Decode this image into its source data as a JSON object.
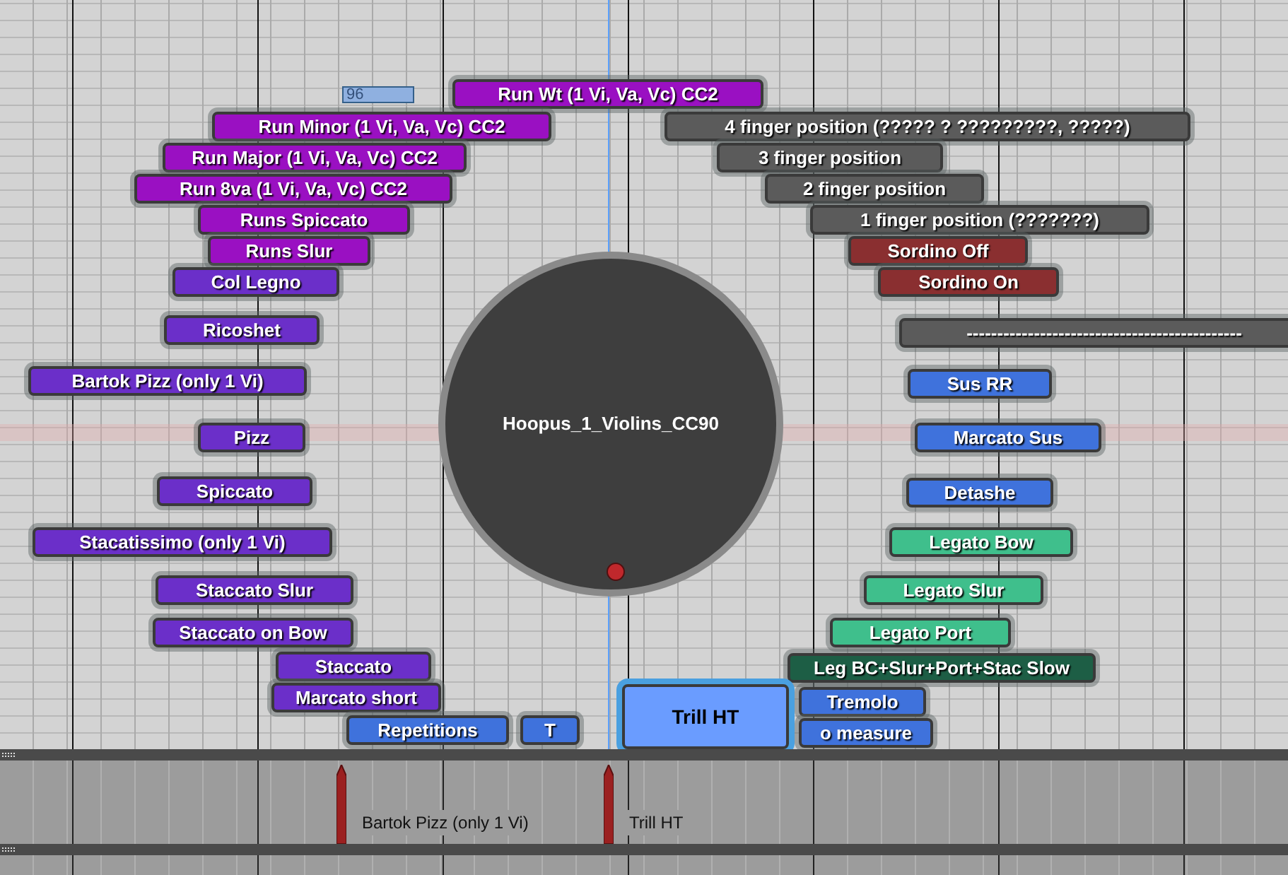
{
  "value_field": "96",
  "center": {
    "title": "Hoopus_1_Violins_CC90"
  },
  "buttons": [
    {
      "label": "Run Wt (1 Vi, Va, Vc) CC2",
      "color": "#9a10c2",
      "selected": false
    },
    {
      "label": "Run Minor (1 Vi, Va, Vc) CC2",
      "color": "#9a10c2",
      "selected": false
    },
    {
      "label": "Run Major (1 Vi, Va, Vc) CC2",
      "color": "#9a10c2",
      "selected": false
    },
    {
      "label": "Run 8va (1 Vi, Va, Vc) CC2",
      "color": "#9a10c2",
      "selected": false
    },
    {
      "label": "Runs Spiccato",
      "color": "#9a10c2",
      "selected": false
    },
    {
      "label": "Runs Slur",
      "color": "#9a10c2",
      "selected": false
    },
    {
      "label": "4 finger position (????? ? ?????????, ?????)",
      "color": "#5b5b5b",
      "selected": false
    },
    {
      "label": "3 finger position",
      "color": "#5b5b5b",
      "selected": false
    },
    {
      "label": "2 finger position",
      "color": "#5b5b5b",
      "selected": false
    },
    {
      "label": "1 finger position (???????)",
      "color": "#5b5b5b",
      "selected": false
    },
    {
      "label": "Sordino Off",
      "color": "#8a2f30",
      "selected": false
    },
    {
      "label": "Col Legno",
      "color": "#6b2fc9",
      "selected": false
    },
    {
      "label": "Sordino On",
      "color": "#8a2f30",
      "selected": false
    },
    {
      "label": "Ricoshet",
      "color": "#6b2fc9",
      "selected": false
    },
    {
      "label": "---------------------------------------------",
      "color": "#5b5b5b",
      "selected": false
    },
    {
      "label": "Sus RR",
      "color": "#3f72dc",
      "selected": false
    },
    {
      "label": "Bartok Pizz (only 1 Vi)",
      "color": "#6b2fc9",
      "selected": false
    },
    {
      "label": "Pizz",
      "color": "#6b2fc9",
      "selected": false
    },
    {
      "label": "Marcato Sus",
      "color": "#3f72dc",
      "selected": false
    },
    {
      "label": "Spiccato",
      "color": "#6b2fc9",
      "selected": false
    },
    {
      "label": "Detashe",
      "color": "#3f72dc",
      "selected": false
    },
    {
      "label": "Stacatissimo (only 1 Vi)",
      "color": "#6b2fc9",
      "selected": false
    },
    {
      "label": "Legato Bow",
      "color": "#3fbf8c",
      "selected": false
    },
    {
      "label": "Staccato Slur",
      "color": "#6b2fc9",
      "selected": false
    },
    {
      "label": "Legato Slur",
      "color": "#3fbf8c",
      "selected": false
    },
    {
      "label": "Staccato on Bow",
      "color": "#6b2fc9",
      "selected": false
    },
    {
      "label": "Legato Port",
      "color": "#3fbf8c",
      "selected": false
    },
    {
      "label": "Staccato",
      "color": "#6b2fc9",
      "selected": false
    },
    {
      "label": "Leg BC+Slur+Port+Stac Slow",
      "color": "#1d5e45",
      "selected": false
    },
    {
      "label": "Marcato short",
      "color": "#6b2fc9",
      "selected": false
    },
    {
      "label": "Repetitions",
      "color": "#3f72dc",
      "selected": false
    },
    {
      "label": "T",
      "color": "#3f72dc",
      "selected": false
    },
    {
      "label": "Trill HT",
      "color": "#6a9cff",
      "selected": true
    },
    {
      "label": "Tremolo",
      "color": "#3f72dc",
      "selected": false
    },
    {
      "label": "o measure",
      "color": "#3f72dc",
      "selected": false
    }
  ],
  "lane_markers": [
    {
      "label": "Bartok Pizz (only 1 Vi)"
    },
    {
      "label": "Trill HT"
    }
  ]
}
